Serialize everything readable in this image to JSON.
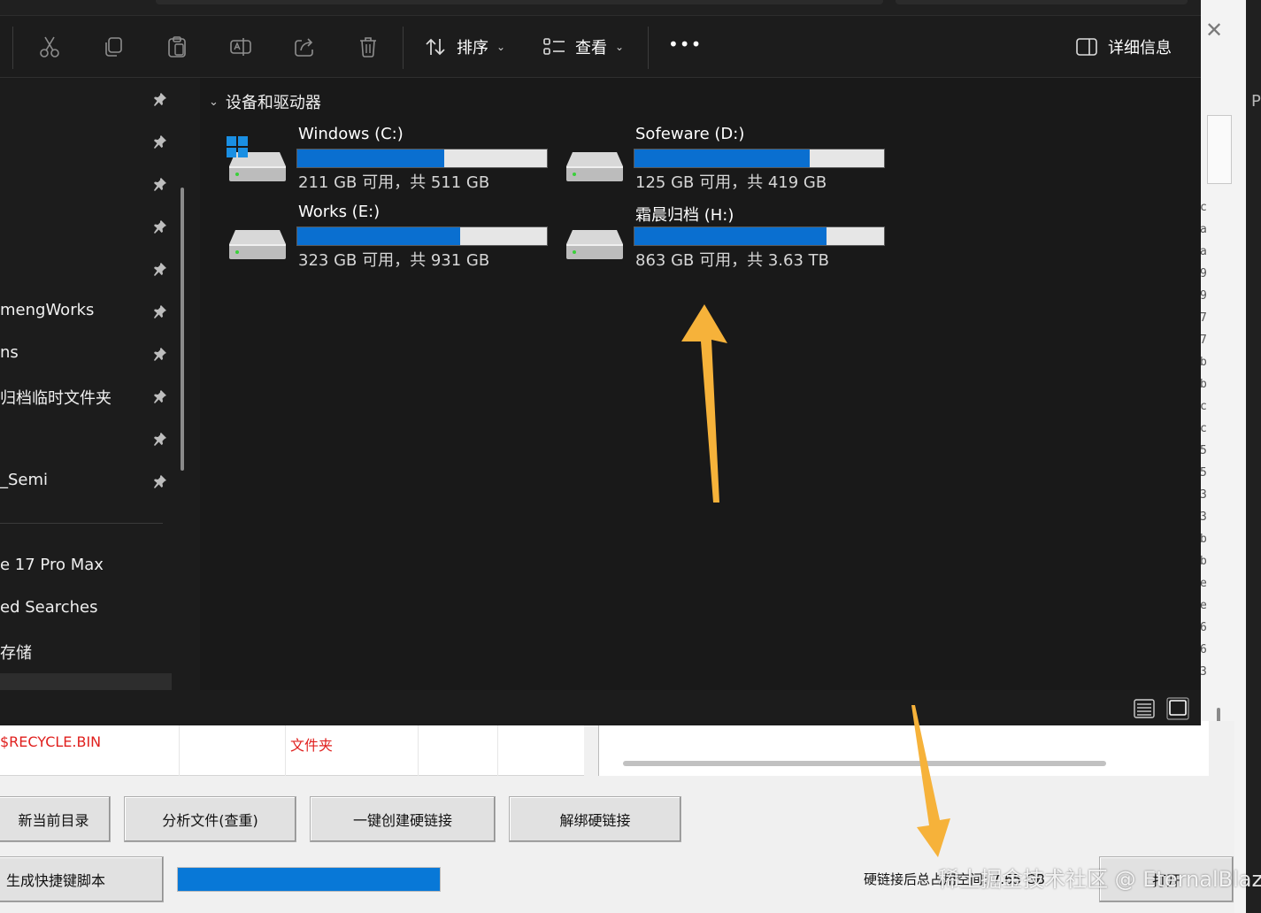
{
  "explorer": {
    "toolbar": {
      "icons": [
        "cut-icon",
        "copy-icon",
        "paste-icon",
        "rename-icon",
        "share-icon",
        "delete-icon"
      ],
      "sort_label": "排序",
      "view_label": "查看",
      "more_label": "•••",
      "details_label": "详细信息"
    },
    "nav": {
      "items": [
        {
          "label": "",
          "pinned": true
        },
        {
          "label": "",
          "pinned": true
        },
        {
          "label": "",
          "pinned": true
        },
        {
          "label": "",
          "pinned": true
        },
        {
          "label": "",
          "pinned": true
        },
        {
          "label": "mengWorks",
          "pinned": true
        },
        {
          "label": "ns",
          "pinned": true
        },
        {
          "label": "归档临时文件夹",
          "pinned": true
        },
        {
          "label": "",
          "pinned": true
        },
        {
          "label": "_Semi",
          "pinned": true
        }
      ],
      "items2": [
        {
          "label": "e 17 Pro Max"
        },
        {
          "label": "ed Searches"
        },
        {
          "label": "存储"
        }
      ]
    },
    "section_title": "设备和驱动器",
    "drives": [
      {
        "name": "Windows (C:)",
        "free": "211 GB 可用，共 511 GB",
        "used_pct": 58.7,
        "icon": "windows-drive-icon"
      },
      {
        "name": "Sofeware (D:)",
        "free": "125 GB 可用，共 419 GB",
        "used_pct": 70.2,
        "icon": "drive-icon"
      },
      {
        "name": "Works (E:)",
        "free": "323 GB 可用，共 931 GB",
        "used_pct": 65.3,
        "icon": "drive-icon"
      },
      {
        "name": "霜晨归档 (H:)",
        "free": "863 GB 可用，共 3.63 TB",
        "used_pct": 76.8,
        "icon": "drive-icon"
      }
    ]
  },
  "bottom_app": {
    "grid_rows": [
      {
        "name": "$RECYCLE.BIN",
        "type": "文件夹"
      }
    ],
    "buttons": {
      "refresh": "新当前目录",
      "analyze": "分析文件(查重)",
      "create_hardlink": "一键创建硬链接",
      "unbind_hardlink": "解绑硬链接",
      "gen_script": "生成快捷键脚本",
      "right_btn": "打开"
    },
    "progress_pct": 100,
    "status_text": "硬链接后总占用空间: 7.65 GB",
    "watermark": "稀土掘金技术社区 @ EternalBlaze",
    "right_strip_chars": [
      "c",
      "a",
      "a",
      "9",
      "9",
      "7",
      "7",
      "b",
      "b",
      "c",
      "c",
      "5",
      "5",
      "3",
      "3",
      "b",
      "b",
      "e",
      "e",
      "6",
      "6",
      "3"
    ],
    "right_letter": "P"
  },
  "colors": {
    "accent": "#0a6fd0",
    "dark_bg": "#1c1c1c",
    "red_text": "#e0201e",
    "arrow": "#f6b23a"
  }
}
